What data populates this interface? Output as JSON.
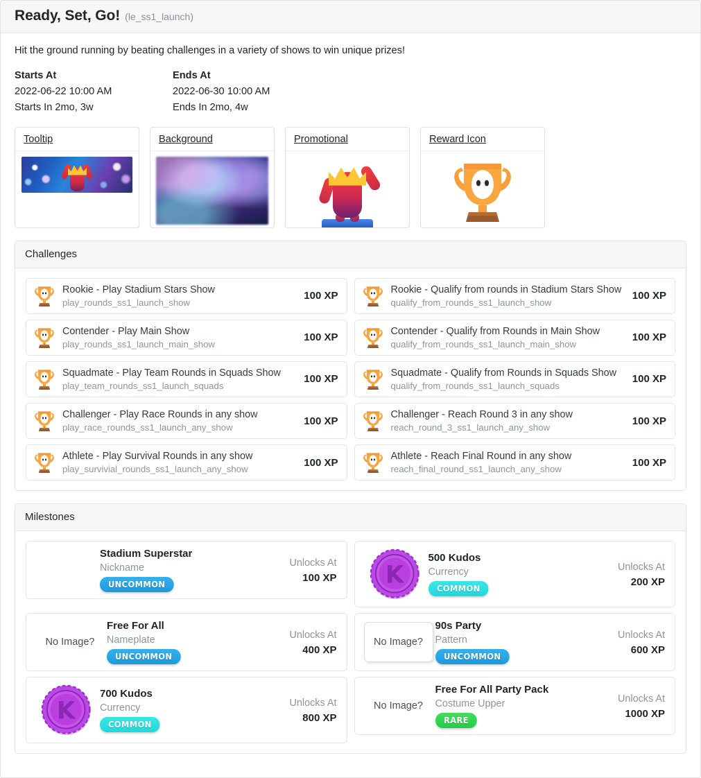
{
  "header": {
    "title": "Ready, Set, Go!",
    "slug": "(le_ss1_launch)"
  },
  "description": "Hit the ground running by beating challenges in a variety of shows to win unique prizes!",
  "dates": {
    "starts_label": "Starts At",
    "starts_value": "2022-06-22 10:00 AM",
    "starts_relative": "Starts In 2mo, 3w",
    "ends_label": "Ends At",
    "ends_value": "2022-06-30 10:00 AM",
    "ends_relative": "Ends In 2mo, 4w"
  },
  "assets": [
    {
      "label": "Tooltip",
      "kind": "banner"
    },
    {
      "label": "Background",
      "kind": "background"
    },
    {
      "label": "Promotional",
      "kind": "character"
    },
    {
      "label": "Reward Icon",
      "kind": "trophy"
    }
  ],
  "challenges": {
    "section_title": "Challenges",
    "items": [
      {
        "name": "Rookie - Play Stadium Stars Show",
        "slug": "play_rounds_ss1_launch_show",
        "xp": "100 XP"
      },
      {
        "name": "Rookie - Qualify from rounds in Stadium Stars Show",
        "slug": "qualify_from_rounds_ss1_launch_show",
        "xp": "100 XP"
      },
      {
        "name": "Contender - Play Main Show",
        "slug": "play_rounds_ss1_launch_main_show",
        "xp": "100 XP"
      },
      {
        "name": "Contender - Qualify from Rounds in Main Show",
        "slug": "qualify_from_rounds_ss1_launch_main_show",
        "xp": "100 XP"
      },
      {
        "name": "Squadmate - Play Team Rounds in Squads Show",
        "slug": "play_team_rounds_ss1_launch_squads",
        "xp": "100 XP"
      },
      {
        "name": "Squadmate - Qualify from Rounds in Squads Show",
        "slug": "qualify_from_rounds_ss1_launch_squads",
        "xp": "100 XP"
      },
      {
        "name": "Challenger - Play Race Rounds in any show",
        "slug": "play_race_rounds_ss1_launch_any_show",
        "xp": "100 XP"
      },
      {
        "name": "Challenger - Reach Round 3 in any show",
        "slug": "reach_round_3_ss1_launch_any_show",
        "xp": "100 XP"
      },
      {
        "name": "Athlete - Play Survival Rounds in any show",
        "slug": "play_survivial_rounds_ss1_launch_any_show",
        "xp": "100 XP"
      },
      {
        "name": "Athlete - Reach Final Round in any show",
        "slug": "reach_final_round_ss1_launch_any_show",
        "xp": "100 XP"
      }
    ]
  },
  "milestones": {
    "section_title": "Milestones",
    "unlocks_label": "Unlocks At",
    "no_image_label": "No Image?",
    "items": [
      {
        "name": "Stadium Superstar",
        "type": "Nickname",
        "rarity": "UNCOMMON",
        "rarity_class": "uncommon",
        "unlocks_at": "100 XP",
        "thumb": "none"
      },
      {
        "name": "500 Kudos",
        "type": "Currency",
        "rarity": "COMMON",
        "rarity_class": "common",
        "unlocks_at": "200 XP",
        "thumb": "coin"
      },
      {
        "name": "Free For All",
        "type": "Nameplate",
        "rarity": "UNCOMMON",
        "rarity_class": "uncommon",
        "unlocks_at": "400 XP",
        "thumb": "noimage"
      },
      {
        "name": "90s Party",
        "type": "Pattern",
        "rarity": "UNCOMMON",
        "rarity_class": "uncommon",
        "unlocks_at": "600 XP",
        "thumb": "noimage-box"
      },
      {
        "name": "700 Kudos",
        "type": "Currency",
        "rarity": "COMMON",
        "rarity_class": "common",
        "unlocks_at": "800 XP",
        "thumb": "coin"
      },
      {
        "name": "Free For All Party Pack",
        "type": "Costume Upper",
        "rarity": "RARE",
        "rarity_class": "rare",
        "unlocks_at": "1000 XP",
        "thumb": "noimage"
      }
    ]
  },
  "colors": {
    "uncommon": "#1b9ade",
    "common": "#1ed9dd",
    "rare": "#24cc46",
    "trophy_orange": "#f5a03c",
    "kudos_purple": "#b544e0",
    "header_bg": "#f7f7f7"
  }
}
